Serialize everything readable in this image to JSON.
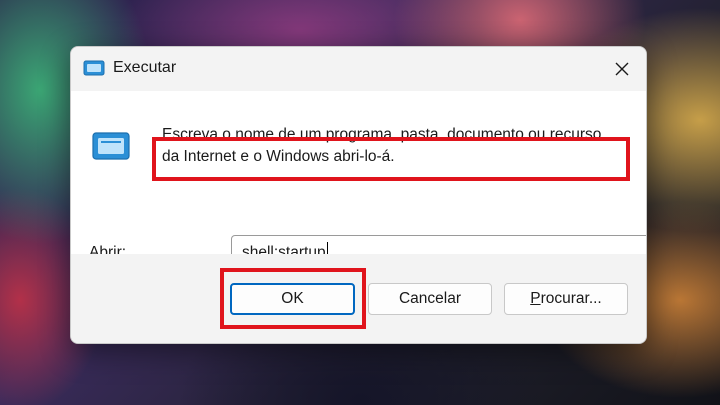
{
  "dialog": {
    "title": "Executar",
    "title_icon": "run-dialog-icon",
    "close_icon": "close-icon",
    "description": "Escreva o nome de um programa, pasta, documento ou recurso da Internet e o Windows abri-lo-á.",
    "open_label_accel": "A",
    "open_label_rest": "brir:",
    "open_value": "shell:startup",
    "dropdown_icon": "chevron-down-icon",
    "buttons": {
      "ok": "OK",
      "cancel": "Cancelar",
      "browse_accel": "P",
      "browse_rest": "rocurar..."
    }
  },
  "colors": {
    "highlight": "#e0141c",
    "accent": "#0067c0",
    "dialog_bg": "#f3f3f3"
  }
}
